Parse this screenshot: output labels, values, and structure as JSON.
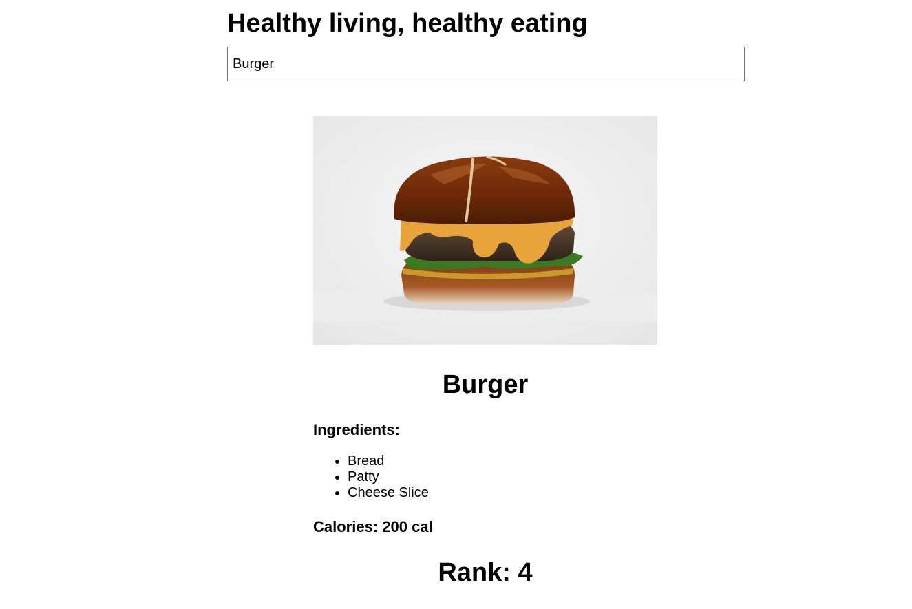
{
  "header": {
    "title": "Healthy living, healthy eating"
  },
  "search": {
    "value": "Burger"
  },
  "food": {
    "image_alt": "burger-photo",
    "name": "Burger",
    "ingredients_label": "Ingredients:",
    "ingredients": [
      "Bread",
      "Patty",
      "Cheese Slice"
    ],
    "calories_label": "Calories:",
    "calories": "200 cal",
    "rank_label": "Rank:",
    "rank": "4"
  }
}
